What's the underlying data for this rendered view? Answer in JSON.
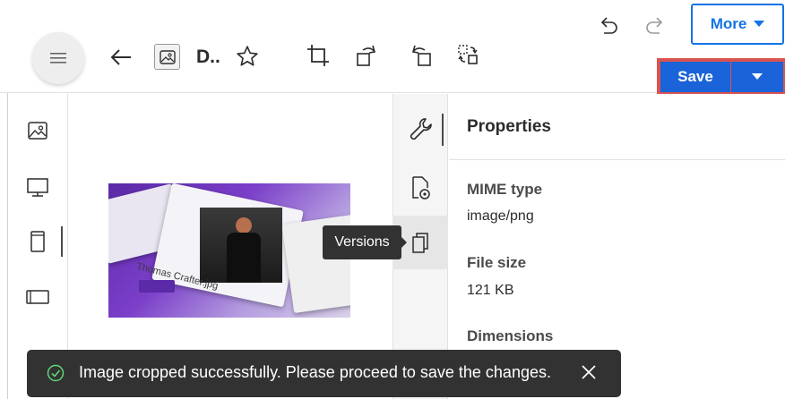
{
  "toolbar": {
    "document_title": "D..",
    "more_label": "More",
    "save_label": "Save"
  },
  "icons": {
    "menu": "hamburger-icon",
    "back": "arrow-left-icon",
    "favorite": "star-icon",
    "crop": "crop-icon",
    "rotate_left": "rotate-left-icon",
    "rotate_right": "rotate-right-icon",
    "flip": "flip-icon",
    "undo": "undo-icon",
    "redo": "redo-icon"
  },
  "left_rail": {
    "items": [
      "image-icon",
      "desktop-icon",
      "tablet-icon",
      "landscape-icon"
    ]
  },
  "preview": {
    "caption": "Thomas Crafter.jpg"
  },
  "side_rail": {
    "items": [
      "wrench-icon",
      "file-preview-icon",
      "versions-icon"
    ],
    "active_tooltip": "Versions"
  },
  "properties": {
    "title": "Properties",
    "fields": [
      {
        "label": "MIME type",
        "value": "image/png"
      },
      {
        "label": "File size",
        "value": "121 KB"
      },
      {
        "label": "Dimensions",
        "value": ""
      }
    ]
  },
  "toast": {
    "message": "Image cropped successfully. Please proceed to save the changes."
  },
  "colors": {
    "primary": "#1473e6",
    "save_bg": "#1a63d8",
    "save_outline": "#d9534f",
    "toast_bg": "#323232"
  }
}
